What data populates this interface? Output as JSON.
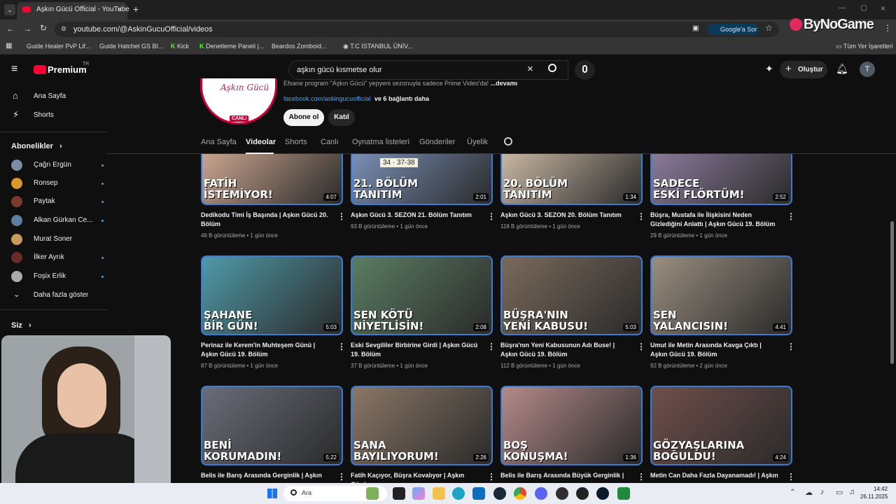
{
  "browser": {
    "tab_title": "Aşkın Gücü Official - YouTube",
    "url": "youtube.com/@AskinGucuOfficial/videos",
    "google_sor": "Google'a Sor",
    "watermark": "ByNoGame",
    "bookmarks": [
      "Guide Healer PvP Lif...",
      "Guide Hatchet GS BI...",
      "Kick",
      "Denetleme Paneli |...",
      "Beardos Zomboid...",
      "T.C İSTANBUL ÜNİV..."
    ],
    "all_bookmarks": "Tüm Yer İşaretleri"
  },
  "youtube": {
    "logo": "Premium",
    "logo_badge": "TR",
    "search_value": "aşkın gücü kısmetse olur",
    "create_label": "Oluştur",
    "user_initial": "T"
  },
  "sidebar": {
    "items": [
      {
        "label": "Ana Sayfa",
        "icon": "home-icon"
      },
      {
        "label": "Shorts",
        "icon": "shorts-icon"
      }
    ],
    "subscriptions_header": "Abonelikler",
    "subscriptions": [
      "Çağrı Ergün",
      "Ronsep",
      "Paytak",
      "Alkan Gürkan Ce...",
      "Murat Soner",
      "İlker Ayrık",
      "Foşix Erlik"
    ],
    "show_more": "Daha fazla göster",
    "you_header": "Siz"
  },
  "channel": {
    "description": "Efsane program \"Aşkın Gücü\" yepyeni sezonuyla sadece Prime Video'da!",
    "more": "...devamı",
    "link": "facebook.com/askingucuofficial",
    "link_more": "ve 6 bağlantı daha",
    "subscribe": "Abone ol",
    "join": "Katıl",
    "live_badge": "CANLI",
    "avatar_text": "Aşkın Gücü",
    "tabs": [
      "Ana Sayfa",
      "Videolar",
      "Shorts",
      "Canlı",
      "Oynatma listeleri",
      "Gönderiler",
      "Üyelik"
    ]
  },
  "videos": [
    {
      "caption1": "FATİH",
      "caption2": "İSTEMİYOR!",
      "duration": "4:07",
      "title": "Dedikodu Timi İş Başında | Aşkın Gücü 20. Bölüm",
      "views": "46 B görüntüleme",
      "ago": "1 gün önce",
      "bg": "#c9a48f"
    },
    {
      "caption1": "21. BÖLÜM",
      "caption2": "TANITIM",
      "duration": "2:01",
      "title": "Aşkın Gücü 3. SEZON 21. Bölüm Tanıtım",
      "views": "93 B görüntüleme",
      "ago": "1 gün önce",
      "bg": "#7a8fb6",
      "numbers": "34 · 37-38"
    },
    {
      "caption1": "20. BÖLÜM",
      "caption2": "TANITIM",
      "duration": "1:34",
      "title": "Aşkın Gücü 3. SEZON 20. Bölüm Tanıtım",
      "views": "118 B görüntüleme",
      "ago": "1 gün önce",
      "bg": "#c8b7a3"
    },
    {
      "caption1": "SADECE",
      "caption2": "ESKİ FLÖRTÜM!",
      "duration": "2:52",
      "title": "Büşra, Mustafa ile İlişkisini Neden Gizlediğini Anlattı | Aşkın Gücü 19. Bölüm",
      "views": "29 B görüntüleme",
      "ago": "1 gün önce",
      "bg": "#8a7a9a"
    },
    {
      "caption1": "ŞAHANE",
      "caption2": "BİR GÜN!",
      "duration": "5:03",
      "title": "Perinaz ile Kerem'in Muhteşem Günü | Aşkın Gücü 19. Bölüm",
      "views": "87 B görüntüleme",
      "ago": "1 gün önce",
      "bg": "#4f9aa8"
    },
    {
      "caption1": "SEN KÖTÜ",
      "caption2": "NİYETLİSİN!",
      "duration": "2:08",
      "title": "Eski Sevgililer Birbirine Girdi | Aşkın Gücü 19. Bölüm",
      "views": "37 B görüntüleme",
      "ago": "1 gün önce",
      "bg": "#5b7d63"
    },
    {
      "caption1": "BÜŞRA'NIN",
      "caption2": "YENİ KABUSU!",
      "duration": "5:03",
      "title": "Büşra'nın Yeni Kabusunun Adı Buse! | Aşkın Gücü 19. Bölüm",
      "views": "112 B görüntüleme",
      "ago": "1 gün önce",
      "bg": "#7b6a5c"
    },
    {
      "caption1": "SEN",
      "caption2": "YALANCISIN!",
      "duration": "4:41",
      "title": "Umut ile Metin Arasında Kavga Çıktı | Aşkın Gücü 19. Bölüm",
      "views": "92 B görüntüleme",
      "ago": "2 gün önce",
      "bg": "#9a8e80"
    },
    {
      "caption1": "BENİ",
      "caption2": "KORUMADIN!",
      "duration": "5:22",
      "title": "Belis ile Barış Arasında Gerginlik | Aşkın",
      "views": "",
      "ago": "",
      "bg": "#6a6d7a"
    },
    {
      "caption1": "SANA",
      "caption2": "BAYILIYORUM!",
      "duration": "2:26",
      "title": "Fatih Kaçıyor, Büşra Kovalıyor | Aşkın Gücü",
      "views": "",
      "ago": "",
      "bg": "#8b7767"
    },
    {
      "caption1": "BOŞ",
      "caption2": "KONUŞMA!",
      "duration": "1:36",
      "title": "Belis ile Barış Arasında Büyük Gerginlik |",
      "views": "",
      "ago": "",
      "bg": "#b58a8a"
    },
    {
      "caption1": "GÖZYAŞLARINA",
      "caption2": "BOĞULDU!",
      "duration": "4:24",
      "title": "Metin Can Daha Fazla Dayanamadı! | Aşkın",
      "views": "",
      "ago": "",
      "bg": "#6f4f4a"
    }
  ],
  "taskbar": {
    "search_placeholder": "Ara",
    "time": "14:42",
    "date": "26.11.2025"
  }
}
